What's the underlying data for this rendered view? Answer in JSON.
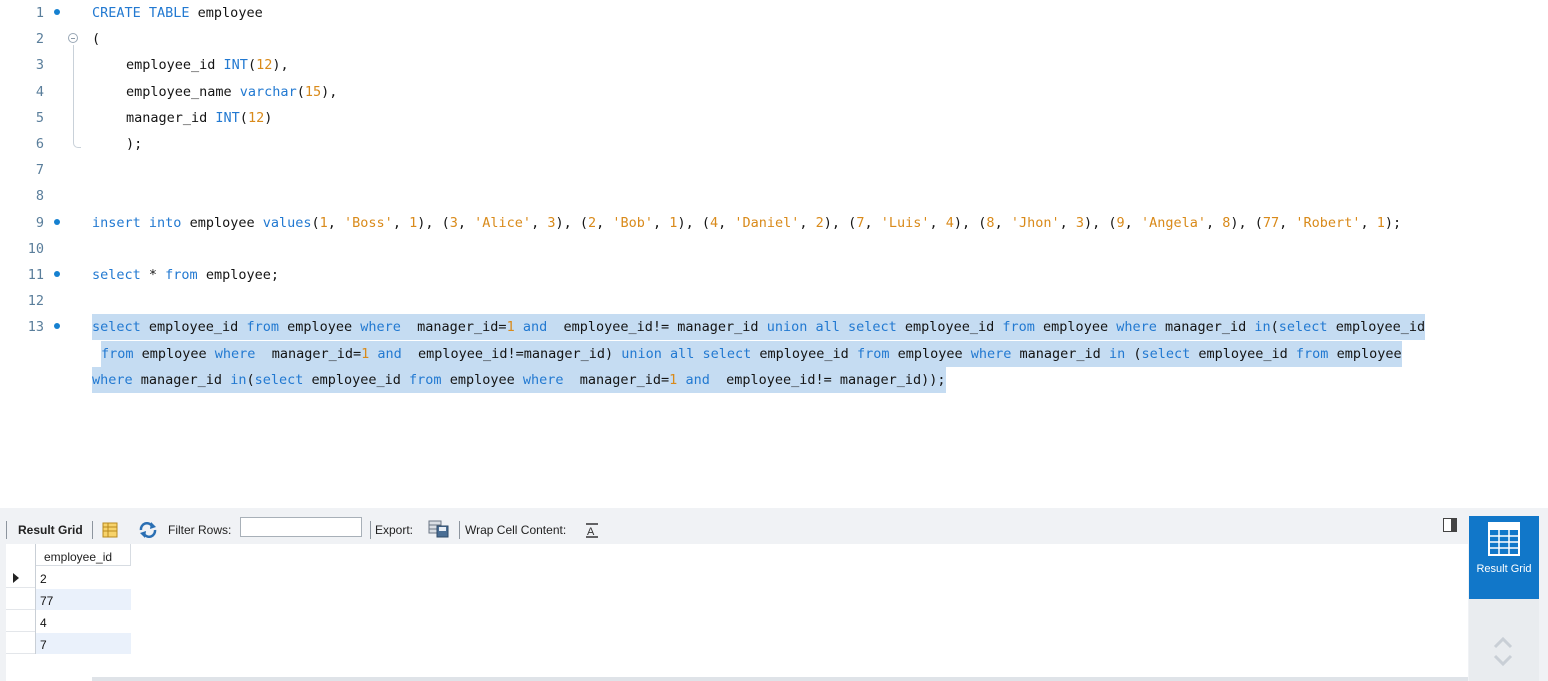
{
  "editor": {
    "lines": [
      {
        "number": "1",
        "marker": true,
        "tokens": [
          {
            "t": "CREATE TABLE",
            "c": "kw"
          },
          {
            "t": " employee",
            "c": ""
          }
        ]
      },
      {
        "number": "2",
        "fold": true,
        "tokens": [
          {
            "t": "(",
            "c": ""
          }
        ]
      },
      {
        "number": "3",
        "indent": true,
        "tokens": [
          {
            "t": "employee_id ",
            "c": ""
          },
          {
            "t": "INT",
            "c": "kw"
          },
          {
            "t": "(",
            "c": ""
          },
          {
            "t": "12",
            "c": "num"
          },
          {
            "t": "),",
            "c": ""
          }
        ]
      },
      {
        "number": "4",
        "indent": true,
        "tokens": [
          {
            "t": "employee_name ",
            "c": ""
          },
          {
            "t": "varchar",
            "c": "kw"
          },
          {
            "t": "(",
            "c": ""
          },
          {
            "t": "15",
            "c": "num"
          },
          {
            "t": "),",
            "c": ""
          }
        ]
      },
      {
        "number": "5",
        "indent": true,
        "tokens": [
          {
            "t": "manager_id ",
            "c": ""
          },
          {
            "t": "INT",
            "c": "kw"
          },
          {
            "t": "(",
            "c": ""
          },
          {
            "t": "12",
            "c": "num"
          },
          {
            "t": ")",
            "c": ""
          }
        ]
      },
      {
        "number": "6",
        "indent": true,
        "tokens": [
          {
            "t": ");",
            "c": ""
          }
        ]
      },
      {
        "number": "7",
        "tokens": []
      },
      {
        "number": "8",
        "tokens": []
      },
      {
        "number": "9",
        "marker": true,
        "tokens": [
          {
            "t": "insert",
            "c": "kw"
          },
          {
            "t": " ",
            "c": ""
          },
          {
            "t": "into",
            "c": "kw"
          },
          {
            "t": " employee ",
            "c": ""
          },
          {
            "t": "values",
            "c": "kw"
          },
          {
            "t": "(",
            "c": ""
          },
          {
            "t": "1",
            "c": "num"
          },
          {
            "t": ", ",
            "c": ""
          },
          {
            "t": "'Boss'",
            "c": "str"
          },
          {
            "t": ", ",
            "c": ""
          },
          {
            "t": "1",
            "c": "num"
          },
          {
            "t": "), (",
            "c": ""
          },
          {
            "t": "3",
            "c": "num"
          },
          {
            "t": ", ",
            "c": ""
          },
          {
            "t": "'Alice'",
            "c": "str"
          },
          {
            "t": ", ",
            "c": ""
          },
          {
            "t": "3",
            "c": "num"
          },
          {
            "t": "), (",
            "c": ""
          },
          {
            "t": "2",
            "c": "num"
          },
          {
            "t": ", ",
            "c": ""
          },
          {
            "t": "'Bob'",
            "c": "str"
          },
          {
            "t": ", ",
            "c": ""
          },
          {
            "t": "1",
            "c": "num"
          },
          {
            "t": "), (",
            "c": ""
          },
          {
            "t": "4",
            "c": "num"
          },
          {
            "t": ", ",
            "c": ""
          },
          {
            "t": "'Daniel'",
            "c": "str"
          },
          {
            "t": ", ",
            "c": ""
          },
          {
            "t": "2",
            "c": "num"
          },
          {
            "t": "), (",
            "c": ""
          },
          {
            "t": "7",
            "c": "num"
          },
          {
            "t": ", ",
            "c": ""
          },
          {
            "t": "'Luis'",
            "c": "str"
          },
          {
            "t": ", ",
            "c": ""
          },
          {
            "t": "4",
            "c": "num"
          },
          {
            "t": "), (",
            "c": ""
          },
          {
            "t": "8",
            "c": "num"
          },
          {
            "t": ", ",
            "c": ""
          },
          {
            "t": "'Jhon'",
            "c": "str"
          },
          {
            "t": ", ",
            "c": ""
          },
          {
            "t": "3",
            "c": "num"
          },
          {
            "t": "), (",
            "c": ""
          },
          {
            "t": "9",
            "c": "num"
          },
          {
            "t": ", ",
            "c": ""
          },
          {
            "t": "'Angela'",
            "c": "str"
          },
          {
            "t": ", ",
            "c": ""
          },
          {
            "t": "8",
            "c": "num"
          },
          {
            "t": "), (",
            "c": ""
          },
          {
            "t": "77",
            "c": "num"
          },
          {
            "t": ", ",
            "c": ""
          },
          {
            "t": "'Robert'",
            "c": "str"
          },
          {
            "t": ", ",
            "c": ""
          },
          {
            "t": "1",
            "c": "num"
          },
          {
            "t": ");",
            "c": ""
          }
        ]
      },
      {
        "number": "10",
        "tokens": []
      },
      {
        "number": "11",
        "marker": true,
        "tokens": [
          {
            "t": "select",
            "c": "kw"
          },
          {
            "t": " * ",
            "c": ""
          },
          {
            "t": "from",
            "c": "kw"
          },
          {
            "t": " employee;",
            "c": ""
          }
        ]
      },
      {
        "number": "12",
        "tokens": []
      },
      {
        "number": "13",
        "marker": true,
        "selected": true,
        "tokens": [
          {
            "t": "select",
            "c": "kw"
          },
          {
            "t": " employee_id ",
            "c": ""
          },
          {
            "t": "from",
            "c": "kw"
          },
          {
            "t": " employee ",
            "c": ""
          },
          {
            "t": "where",
            "c": "kw"
          },
          {
            "t": "  manager_id=",
            "c": ""
          },
          {
            "t": "1",
            "c": "num"
          },
          {
            "t": " ",
            "c": ""
          },
          {
            "t": "and",
            "c": "kw"
          },
          {
            "t": "  employee_id!= manager_id ",
            "c": ""
          },
          {
            "t": "union all select",
            "c": "kw"
          },
          {
            "t": " employee_id ",
            "c": ""
          },
          {
            "t": "from",
            "c": "kw"
          },
          {
            "t": " employee ",
            "c": ""
          },
          {
            "t": "where",
            "c": "kw"
          },
          {
            "t": " manager_id ",
            "c": ""
          },
          {
            "t": "in",
            "c": "kw"
          },
          {
            "t": "(",
            "c": ""
          },
          {
            "t": "select",
            "c": "kw"
          },
          {
            "t": " employee_id",
            "c": ""
          }
        ]
      },
      {
        "number": "",
        "selected": true,
        "cont": true,
        "tokens": [
          {
            "t": "from",
            "c": "kw"
          },
          {
            "t": " employee ",
            "c": ""
          },
          {
            "t": "where",
            "c": "kw"
          },
          {
            "t": "  manager_id=",
            "c": ""
          },
          {
            "t": "1",
            "c": "num"
          },
          {
            "t": " ",
            "c": ""
          },
          {
            "t": "and",
            "c": "kw"
          },
          {
            "t": "  employee_id!=manager_id) ",
            "c": ""
          },
          {
            "t": "union all select",
            "c": "kw"
          },
          {
            "t": " employee_id ",
            "c": ""
          },
          {
            "t": "from",
            "c": "kw"
          },
          {
            "t": " employee ",
            "c": ""
          },
          {
            "t": "where",
            "c": "kw"
          },
          {
            "t": " manager_id ",
            "c": ""
          },
          {
            "t": "in",
            "c": "kw"
          },
          {
            "t": " (",
            "c": ""
          },
          {
            "t": "select",
            "c": "kw"
          },
          {
            "t": " employee_id ",
            "c": ""
          },
          {
            "t": "from",
            "c": "kw"
          },
          {
            "t": " employee",
            "c": ""
          }
        ]
      },
      {
        "number": "",
        "selected": true,
        "tokens": [
          {
            "t": "where",
            "c": "kw"
          },
          {
            "t": " manager_id ",
            "c": ""
          },
          {
            "t": "in",
            "c": "kw"
          },
          {
            "t": "(",
            "c": ""
          },
          {
            "t": "select",
            "c": "kw"
          },
          {
            "t": " employee_id ",
            "c": ""
          },
          {
            "t": "from",
            "c": "kw"
          },
          {
            "t": " employee ",
            "c": ""
          },
          {
            "t": "where",
            "c": "kw"
          },
          {
            "t": "  manager_id=",
            "c": ""
          },
          {
            "t": "1",
            "c": "num"
          },
          {
            "t": " ",
            "c": ""
          },
          {
            "t": "and",
            "c": "kw"
          },
          {
            "t": "  employee_id!= manager_id));",
            "c": ""
          }
        ]
      }
    ]
  },
  "toolbar": {
    "result_grid_label": "Result Grid",
    "filter_rows_label": "Filter Rows:",
    "filter_value": "",
    "export_label": "Export:",
    "wrap_label": "Wrap Cell Content:"
  },
  "grid": {
    "columns": [
      "employee_id"
    ],
    "rows": [
      [
        "2"
      ],
      [
        "77"
      ],
      [
        "4"
      ],
      [
        "7"
      ]
    ]
  },
  "side_panel": {
    "result_grid_button": "Result Grid"
  },
  "colors": {
    "keyword": "#2279d1",
    "number": "#d98a1a",
    "selection": "#c5dcf2",
    "accent": "#1177c9"
  }
}
